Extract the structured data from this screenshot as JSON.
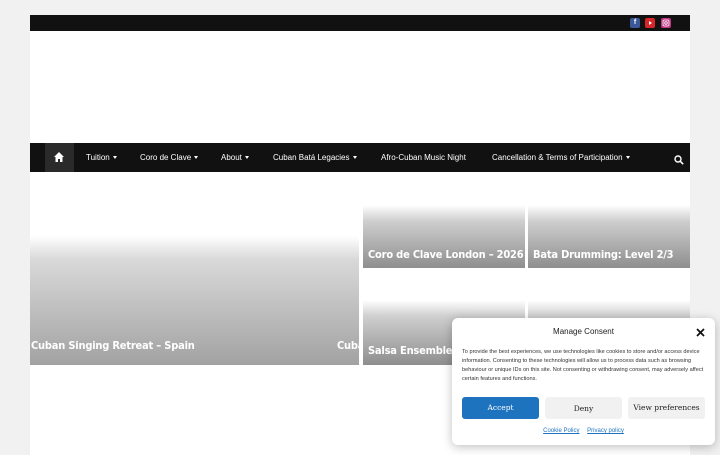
{
  "social": {
    "icons": [
      "facebook-icon",
      "youtube-icon",
      "instagram-icon"
    ],
    "facebook_letter": "f",
    "colors": {
      "facebook": "#3b5998",
      "youtube": "#d9252a",
      "instagram": "#c13584"
    }
  },
  "nav": {
    "items": [
      {
        "label": "Tuition",
        "dropdown": true
      },
      {
        "label": "Coro de Clave",
        "dropdown": true
      },
      {
        "label": "About",
        "dropdown": true
      },
      {
        "label": "Cuban Batá Legacies",
        "dropdown": true
      },
      {
        "label": "Afro-Cuban Music Night",
        "dropdown": false
      },
      {
        "label": "Cancellation & Terms of Participation",
        "dropdown": true
      }
    ]
  },
  "tiles": {
    "big": "Cuban Singing Retreat – Spain",
    "big_partial": "Cuba",
    "a": "Coro de Clave London – 2026",
    "b": "Bata Drumming: Level 2/3",
    "c": "Salsa Ensemble Co"
  },
  "consent": {
    "title": "Manage Consent",
    "text": "To provide the best experiences, we use technologies like cookies to store and/or access device information. Consenting to these technologies will allow us to process data such as browsing behaviour or unique IDs on this site. Not consenting or withdrawing consent, may adversely affect certain features and functions.",
    "accept": "Accept",
    "deny": "Deny",
    "preferences": "View preferences",
    "cookie_policy": "Cookie Policy",
    "privacy_policy": "Privacy policy",
    "accent": "#1e73be"
  }
}
